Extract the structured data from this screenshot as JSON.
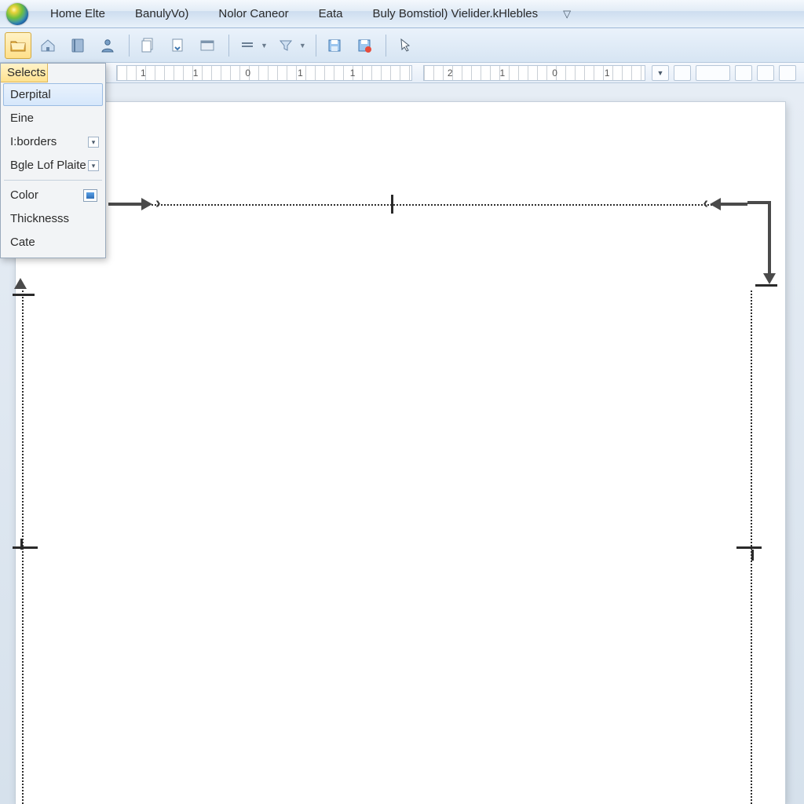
{
  "menubar": {
    "items": [
      "Home Elte",
      "BanulyVo)",
      "Nolor Caneor",
      "Eata",
      "Buly Bomstiol) Vielider.kHlebles"
    ],
    "overflow_glyph": "▽"
  },
  "toolbar": {
    "icons": [
      "folder-open-icon",
      "home-icon",
      "book-icon",
      "person-icon",
      "page-stack-icon",
      "page-arrow-icon",
      "window-icon",
      "lines-icon",
      "filter-icon",
      "save-icon",
      "save-flag-icon",
      "cursor-icon"
    ]
  },
  "ruler": {
    "left_numbers": [
      "1",
      "1",
      "0",
      "1",
      "1"
    ],
    "right_numbers": [
      "2",
      "1",
      "0",
      "1"
    ]
  },
  "dropdown": {
    "header": "Selects",
    "items": [
      {
        "label": "Derpital",
        "hover": true,
        "submenu": false
      },
      {
        "label": "Eine",
        "hover": false,
        "submenu": false
      },
      {
        "label": "I:borders",
        "hover": false,
        "submenu": true
      },
      {
        "label": "Bgle Lof Plaite",
        "hover": false,
        "submenu": true
      }
    ],
    "color_label": "Color",
    "extras": [
      "Thicknesss",
      "Cate"
    ]
  },
  "colors": {
    "accent": "#2f6fb8",
    "panel_bg": "#f2f4f6",
    "highlight": "#ffe28f"
  }
}
